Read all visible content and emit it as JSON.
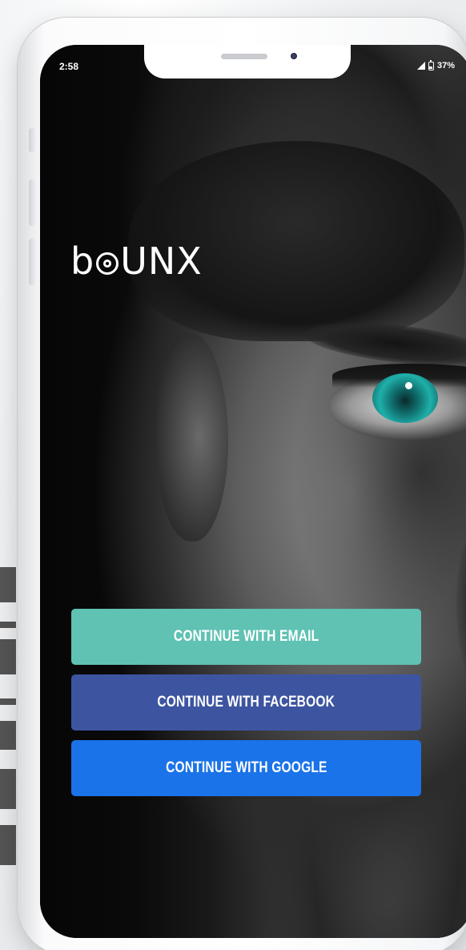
{
  "status_bar": {
    "time": "2:58",
    "battery": "37%"
  },
  "logo": {
    "part1": "b",
    "part2": "UNX"
  },
  "buttons": {
    "email": "CONTINUE WITH EMAIL",
    "facebook": "CONTINUE WITH FACEBOOK",
    "google": "CONTINUE WITH GOOGLE"
  },
  "colors": {
    "email": "#5fc2b3",
    "facebook": "#3d55a0",
    "google": "#1a73e8"
  },
  "icons": [
    "signal-icon",
    "battery-icon"
  ]
}
